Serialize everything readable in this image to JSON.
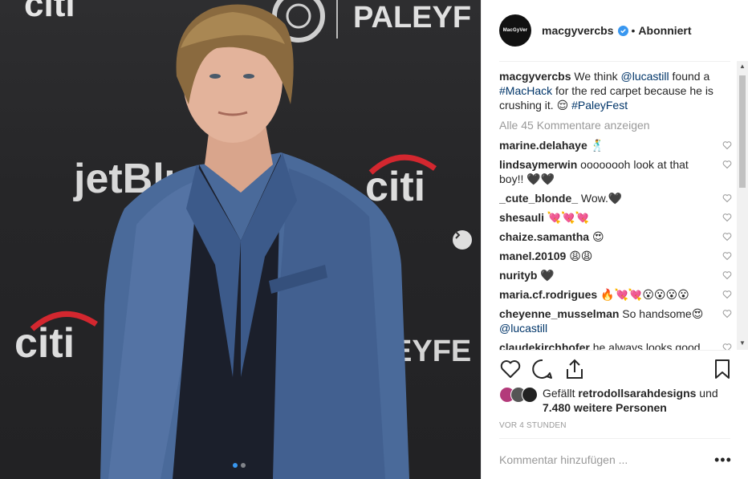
{
  "photo": {
    "backdrop_texts": [
      "citi",
      "PALEYF",
      "jetBlu",
      "citi",
      "citi",
      "EYFE"
    ],
    "carousel_dots": 2,
    "active_dot": 0
  },
  "header": {
    "avatar_text": "MacGyVer",
    "username": "macgyvercbs",
    "separator": "•",
    "follow_state": "Abonniert"
  },
  "caption": {
    "username": "macgyvercbs",
    "parts": [
      "We think ",
      "@lucastill",
      " found a ",
      "#MacHack",
      " for the red carpet because he is crushing it. 😌 ",
      "#PaleyFest"
    ]
  },
  "view_all": "Alle 45 Kommentare anzeigen",
  "comments": [
    {
      "user": "marine.delahaye",
      "text": "🕺",
      "mention": ""
    },
    {
      "user": "lindsaymerwin",
      "text": "oooooooh look at that boy!! 🖤🖤",
      "mention": ""
    },
    {
      "user": "_cute_blonde_",
      "text": "Wow.🖤",
      "mention": ""
    },
    {
      "user": "shesauli",
      "text": "💘💘💘",
      "mention": ""
    },
    {
      "user": "chaize.samantha",
      "text": "😍",
      "mention": ""
    },
    {
      "user": "manel.20109",
      "text": "😩😩",
      "mention": ""
    },
    {
      "user": "nurityb",
      "text": "🖤",
      "mention": ""
    },
    {
      "user": "maria.cf.rodrigues",
      "text": "🔥💘💘😮😮😮😮",
      "mention": ""
    },
    {
      "user": "cheyenne_musselman",
      "text": "So handsome😍",
      "mention": "@lucastill"
    },
    {
      "user": "claudekirchhofer",
      "text": "he always looks good",
      "mention": ""
    }
  ],
  "likes": {
    "text_prefix": "Gefällt ",
    "user": "retrodollsarahdesigns",
    "text_suffix": " und",
    "count_text": "7.480 weitere Personen"
  },
  "timestamp": "VOR 4 STUNDEN",
  "comment_placeholder": "Kommentar hinzufügen ...",
  "more_label": "•••",
  "colors": {
    "link": "#003569",
    "verified": "#3897f0",
    "muted": "#999999",
    "text": "#262626"
  }
}
